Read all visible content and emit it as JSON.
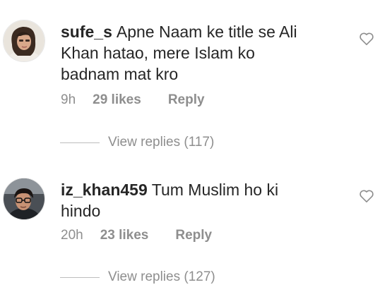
{
  "comments": [
    {
      "username": "sufe_s",
      "text": "Apne Naam ke title se Ali Khan hatao, mere Islam ko badnam mat kro",
      "time": "9h",
      "likes": "29 likes",
      "reply_label": "Reply",
      "view_replies": "View replies (117)",
      "avatar_icon": "woman-selfie-avatar"
    },
    {
      "username": "iz_khan459",
      "text": "Tum Muslim ho ki hindo",
      "time": "20h",
      "likes": "23 likes",
      "reply_label": "Reply",
      "view_replies": "View replies (127)",
      "avatar_icon": "man-with-glasses-avatar"
    }
  ],
  "icons": {
    "like": "heart-outline-icon"
  },
  "colors": {
    "primary_text": "#262626",
    "secondary_text": "#8e8e8e"
  }
}
